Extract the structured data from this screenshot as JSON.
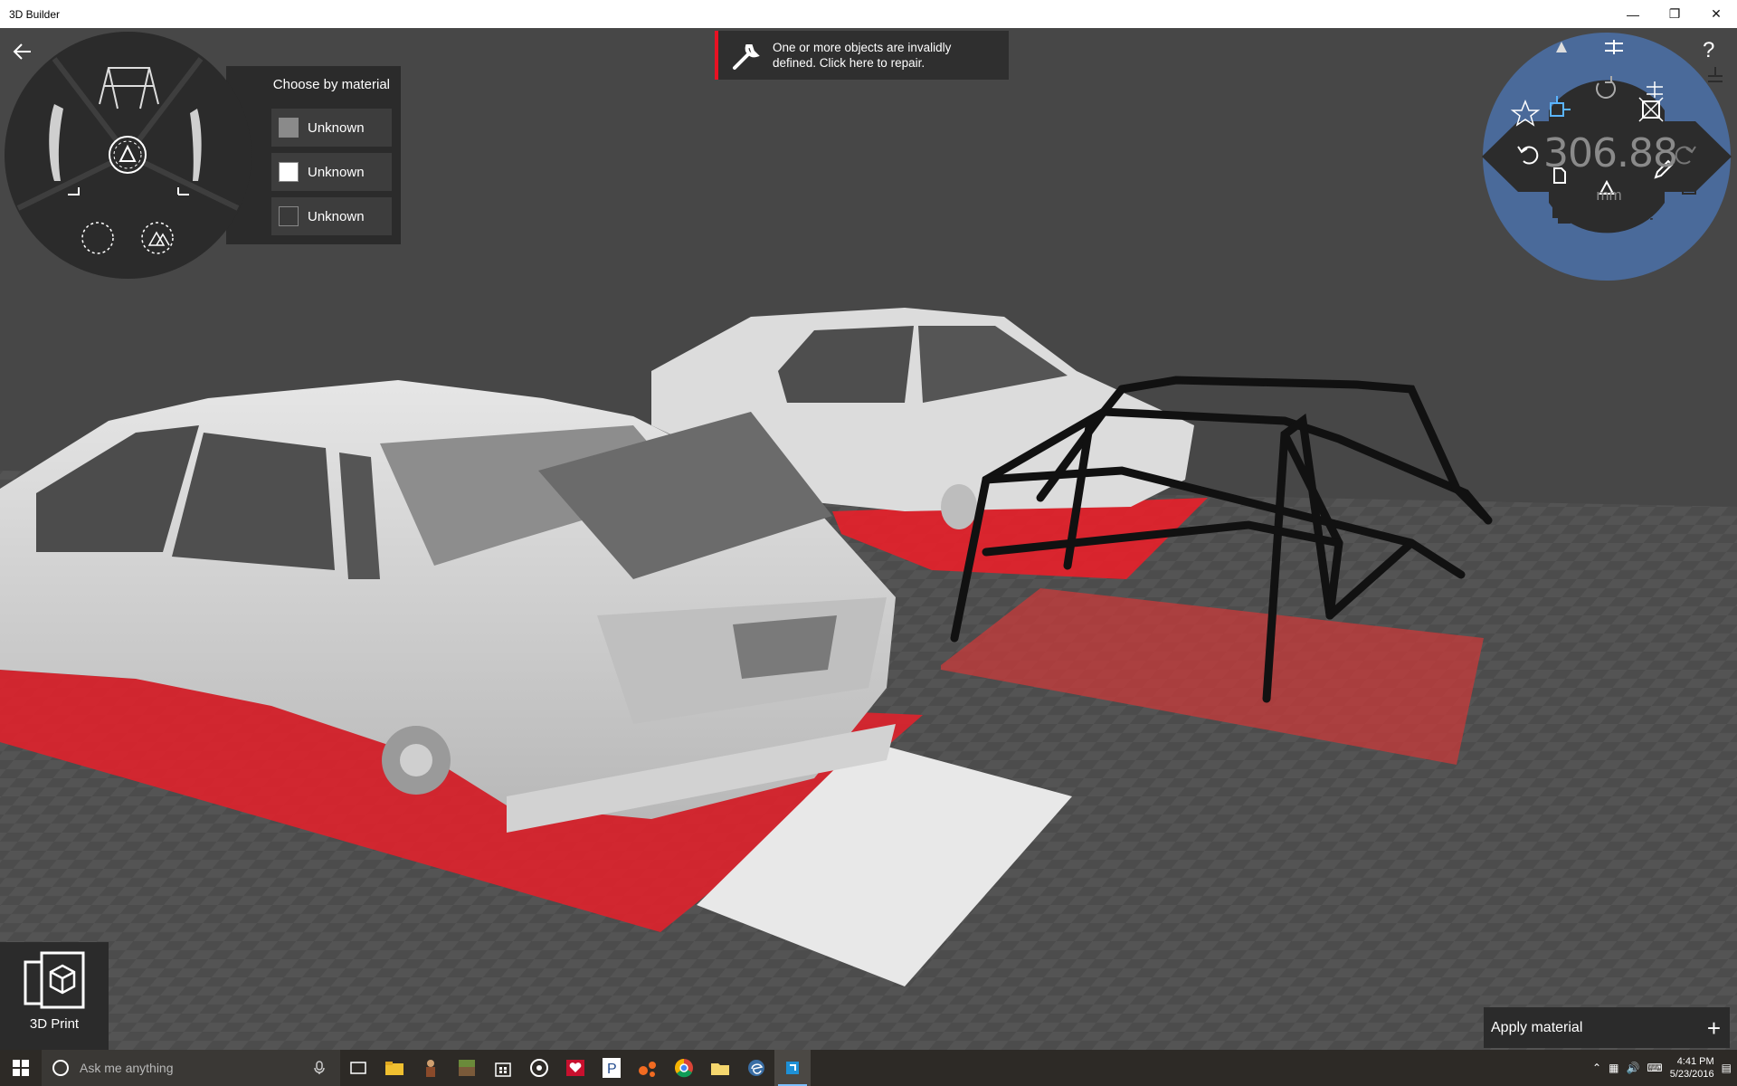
{
  "window": {
    "title": "3D Builder",
    "minimize_icon": "minimize-icon",
    "restore_icon": "restore-icon",
    "close_icon": "close-icon"
  },
  "notification": {
    "icon": "wrench-icon",
    "text_line1": "One or more objects are invalidly",
    "text_line2": "defined. Click here to repair.",
    "accent_color": "#e81123"
  },
  "material_picker": {
    "title": "Choose by material",
    "items": [
      {
        "label": "Unknown",
        "swatch_color": "#8a8a8a"
      },
      {
        "label": "Unknown",
        "swatch_color": "#ffffff"
      },
      {
        "label": "Unknown",
        "swatch_color": "#3a3a3a"
      }
    ]
  },
  "selection_wheel": {
    "icons": [
      "roll-cage-thumbnail-icon",
      "left-part-thumbnail-icon",
      "right-part-thumbnail-icon",
      "select-by-material-icon",
      "select-none-icon",
      "select-all-icon"
    ]
  },
  "tool_dial": {
    "value": "306.88",
    "unit": "mm",
    "icons": [
      "undo-icon",
      "redo-icon",
      "rotate-icon",
      "move-icon",
      "scale-icon",
      "favorite-icon",
      "align-icon",
      "distribute-icon",
      "lay-flat-icon",
      "edit-icon",
      "new-object-icon",
      "triangle-icon",
      "duplicate-icon",
      "group-icon",
      "mirror-icon",
      "settle-icon"
    ]
  },
  "print_button": {
    "label": "3D Print",
    "icon": "3d-print-icon"
  },
  "apply_material": {
    "label": "Apply material",
    "icon": "plus-icon"
  },
  "help": {
    "label": "?"
  },
  "taskbar": {
    "search_placeholder": "Ask me anything",
    "apps": [
      "task-view-icon",
      "file-explorer-icon",
      "app-person-icon",
      "minecraft-icon",
      "store-icon",
      "groove-icon",
      "iheart-icon",
      "pandora-icon",
      "shapes-icon",
      "chrome-icon",
      "folder-icon",
      "edge-like-icon",
      "3d-builder-icon"
    ],
    "time": "4:41 PM",
    "date": "5/23/2016"
  },
  "colors": {
    "viewport_bg": "#4a4a4a",
    "panel_bg": "#2b2b2b",
    "dial_blue": "#4a6a9a",
    "selection_red": "#e8202a"
  }
}
